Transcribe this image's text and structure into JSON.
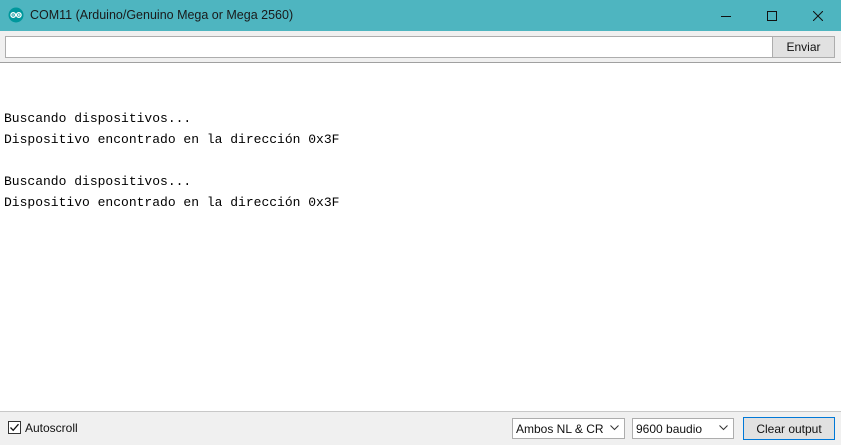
{
  "window": {
    "title": "COM11 (Arduino/Genuino Mega or Mega 2560)",
    "icon": "arduino-logo-icon",
    "titlebar_color": "#4eb5c0"
  },
  "send_bar": {
    "input_value": "",
    "send_label": "Enviar"
  },
  "output": {
    "lines": [
      "Buscando dispositivos...",
      "Dispositivo encontrado en la dirección 0x3F",
      "",
      "Buscando dispositivos...",
      "Dispositivo encontrado en la dirección 0x3F"
    ]
  },
  "bottom_bar": {
    "autoscroll_label": "Autoscroll",
    "autoscroll_checked": true,
    "line_ending": "Ambos NL & CR",
    "baud_rate": "9600 baudio",
    "clear_label": "Clear output"
  }
}
